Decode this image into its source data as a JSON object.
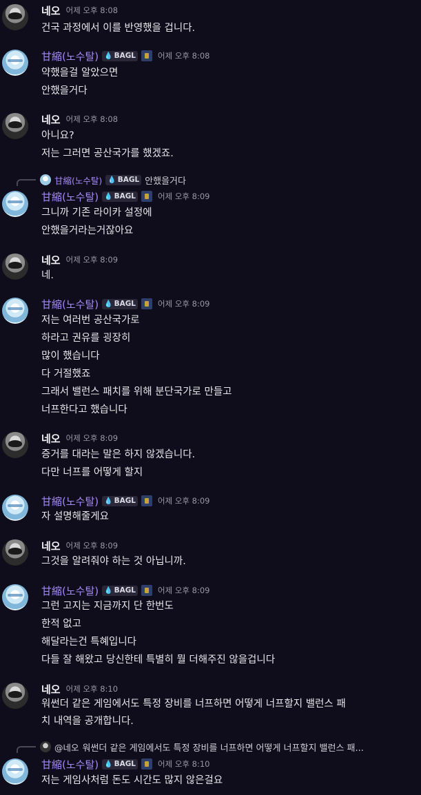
{
  "users": {
    "neo": {
      "name": "네오"
    },
    "gam": {
      "name": "甘縮(노수탈)",
      "tag": "BAGL"
    }
  },
  "messages": [
    {
      "user": "neo",
      "time": "어제 오후 8:08",
      "lines": [
        "건국 과정에서 이를 반영했을 겁니다."
      ]
    },
    {
      "user": "gam",
      "time": "어제 오후 8:08",
      "lines": [
        "약했을걸 알았으면",
        "안했을거다"
      ]
    },
    {
      "user": "neo",
      "time": "어제 오후 8:08",
      "lines": [
        "아니요?",
        "저는 그러면 공산국가를 했겠죠."
      ]
    },
    {
      "user": "gam",
      "time": "어제 오후 8:09",
      "reply": {
        "name": "甘縮(노수탈)",
        "tag": "BAGL",
        "text": "안했을거다"
      },
      "lines": [
        "그니까 기존 라이카 설정에",
        "안했을거라는거잖아요"
      ]
    },
    {
      "user": "neo",
      "time": "어제 오후 8:09",
      "lines": [
        "네."
      ]
    },
    {
      "user": "gam",
      "time": "어제 오후 8:09",
      "lines": [
        "저는 여러번 공산국가로",
        "하라고 권유를 굉장히",
        "많이 했습니다",
        "다 거절했죠",
        "그래서 밸런스 패치를 위해 분단국가로 만들고",
        "너프한다고 했습니다"
      ]
    },
    {
      "user": "neo",
      "time": "어제 오후 8:09",
      "lines": [
        "증거를 대라는 말은 하지 않겠습니다.",
        "다만 너프를 어떻게 할지"
      ]
    },
    {
      "user": "gam",
      "time": "어제 오후 8:09",
      "lines": [
        "자 설명해줄게요"
      ]
    },
    {
      "user": "neo",
      "time": "어제 오후 8:09",
      "lines": [
        "그것을 알려줘야 하는 것 아닙니까."
      ]
    },
    {
      "user": "gam",
      "time": "어제 오후 8:09",
      "lines": [
        "그런 고지는 지금까지 단 한번도",
        "한적 없고",
        "해달라는건 특혜입니다",
        "다들 잘 해왔고 당신한테 특별히 뭘 더해주진 않을겁니다"
      ]
    },
    {
      "user": "neo",
      "time": "어제 오후 8:10",
      "lines": [
        "워썬더 같은 게임에서도 특정 장비를 너프하면 어떻게 너프할지 밸런스 패",
        "치 내역을 공개합니다."
      ]
    },
    {
      "user": "gam",
      "time": "어제 오후 8:10",
      "reply": {
        "name": "@네오",
        "text": "워썬더 같은 게임에서도 특정 장비를 너프하면 어떻게 너프할지 밸런스 패..."
      },
      "lines": [
        "저는 게임사처럼 돈도 시간도 많지 않은걸요"
      ]
    }
  ]
}
